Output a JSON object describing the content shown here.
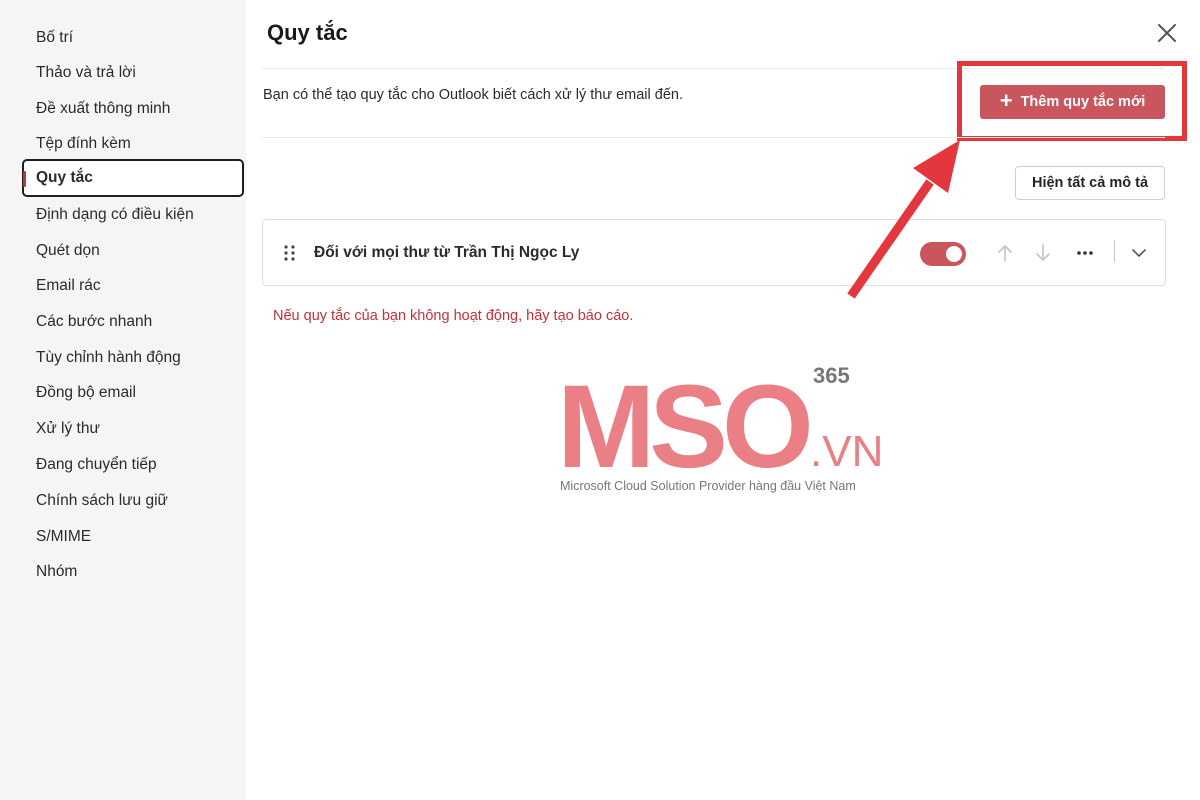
{
  "sidebar": {
    "items": [
      {
        "label": "Bố trí"
      },
      {
        "label": "Thảo và trả lời"
      },
      {
        "label": "Đề xuất thông minh"
      },
      {
        "label": "Tệp đính kèm"
      },
      {
        "label": "Quy tắc",
        "active": true
      },
      {
        "label": "Định dạng có điều kiện"
      },
      {
        "label": "Quét dọn"
      },
      {
        "label": "Email rác"
      },
      {
        "label": "Các bước nhanh"
      },
      {
        "label": "Tùy chỉnh hành động"
      },
      {
        "label": "Đồng bộ email"
      },
      {
        "label": "Xử lý thư"
      },
      {
        "label": "Đang chuyển tiếp"
      },
      {
        "label": "Chính sách lưu giữ"
      },
      {
        "label": "S/MIME"
      },
      {
        "label": "Nhóm"
      }
    ]
  },
  "main": {
    "title": "Quy tắc",
    "description": "Bạn có thể tạo quy tắc cho Outlook biết cách xử lý thư email đến.",
    "add_rule_label": "Thêm quy tắc mới",
    "show_all_label": "Hiện tất cả mô tả",
    "rules": [
      {
        "name": "Đối với mọi thư từ Trần Thị Ngọc Ly",
        "enabled": true
      }
    ],
    "report_text": "Nếu quy tắc của bạn không hoạt động, hãy tạo báo cáo."
  },
  "watermark": {
    "brand": "MSO",
    "superscript": "365",
    "suffix": ".VN",
    "caption": "Microsoft Cloud Solution Provider hàng đầu Việt Nam"
  },
  "colors": {
    "accent": "#c9565d",
    "highlight": "#e3373d",
    "sidebar_bg": "#f5f5f5",
    "link": "#c4313a",
    "logo": "#ea7f86"
  },
  "icons": [
    "close-icon",
    "plus-icon",
    "drag-handle-icon",
    "arrow-up-icon",
    "arrow-down-icon",
    "more-icon",
    "chevron-down-icon"
  ]
}
